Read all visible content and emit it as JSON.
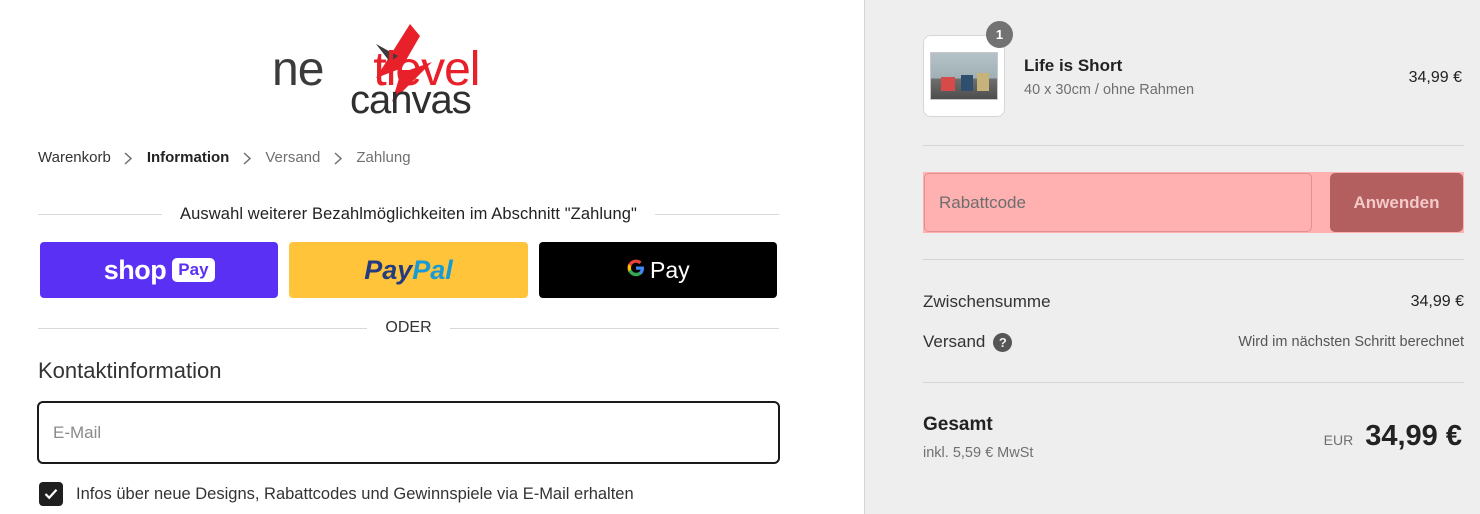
{
  "logo": {
    "line1_a": "ne",
    "line1_b": "tlevel",
    "line2": "canvas"
  },
  "breadcrumb": [
    "Warenkorb",
    "Information",
    "Versand",
    "Zahlung"
  ],
  "express": {
    "title": "Auswahl weiterer Bezahlmöglichkeiten im Abschnitt \"Zahlung\"",
    "shop_label": "shop",
    "shop_pill": "Pay",
    "paypal_a": "Pay",
    "paypal_b": "Pal",
    "gpay_g": "G",
    "gpay_label": "Pay",
    "or": "ODER"
  },
  "contact": {
    "title": "Kontaktinformation",
    "email_placeholder": "E-Mail",
    "newsletter_label": "Infos über neue Designs, Rabattcodes und Gewinnspiele via E-Mail erhalten",
    "newsletter_checked": true
  },
  "cart": {
    "item": {
      "quantity": "1",
      "name": "Life is Short",
      "variant": "40 x 30cm / ohne Rahmen",
      "price": "34,99 €"
    },
    "discount_placeholder": "Rabattcode",
    "discount_button": "Anwenden",
    "subtotal_label": "Zwischensumme",
    "subtotal_value": "34,99 €",
    "shipping_label": "Versand",
    "shipping_value": "Wird im nächsten Schritt berechnet",
    "total_label": "Gesamt",
    "tax_note": "inkl. 5,59 € MwSt",
    "currency": "EUR",
    "total_value": "34,99 €"
  },
  "colors": {
    "shop_pay": "#5a31f4",
    "paypal": "#ffc439",
    "gpay": "#000000",
    "logo_red": "#e8202a",
    "discount_highlight": "#ffb0b0",
    "sidebar_bg": "#eeeeee"
  }
}
